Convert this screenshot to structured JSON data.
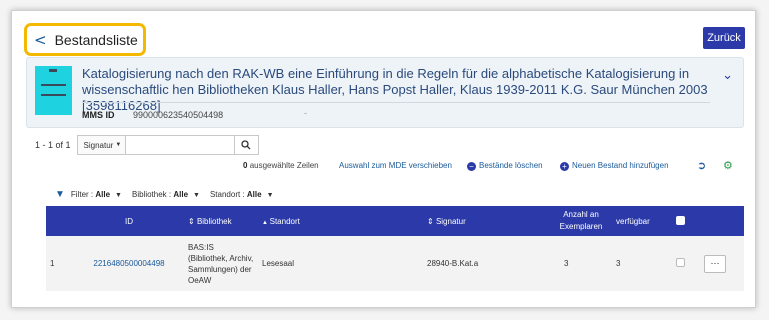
{
  "header": {
    "title": "Bestandsliste",
    "back_label": "Zurück"
  },
  "record": {
    "title": "Katalogisierung nach den RAK-WB eine Einführung in die Regeln für die alphabetische Katalogisierung in wissenschaftlic hen Bibliotheken Klaus Haller, Hans Popst Haller, Klaus 1939-2011 K.G. Saur München 2003 [3598116268]",
    "mms_label": "MMS ID",
    "mms_value": "990000623540504498",
    "mms_extra": "-"
  },
  "toolbar": {
    "count": "1 - 1 of 1",
    "search_field": "Signatur",
    "search_value": ""
  },
  "actions": {
    "selected_count": "0",
    "selected_text": "ausgewählte Zeilen",
    "move": "Auswahl zum MDE verschieben",
    "delete": "Bestände löschen",
    "add": "Neuen Bestand hinzufügen"
  },
  "filters": {
    "label": "Filter :",
    "filter_value": "Alle",
    "library_label": "Bibliothek :",
    "library_value": "Alle",
    "location_label": "Standort :",
    "location_value": "Alle"
  },
  "table": {
    "columns": {
      "id": "ID",
      "library": "Bibliothek",
      "location": "Standort",
      "signature": "Signatur",
      "copies": "Anzahl an Exemplaren",
      "available": "verfügbar"
    },
    "rows": [
      {
        "num": "1",
        "id": "2216480500004498",
        "library": "BAS:IS (Bibliothek, Archiv, Sammlungen) der OeAW",
        "location": "Lesesaal",
        "signature": "28940-B.Kat.a",
        "copies": "3",
        "available": "3"
      }
    ]
  },
  "colors": {
    "accent": "#2b3aa8",
    "highlight": "#f5b800",
    "link": "#1a5a9a"
  }
}
